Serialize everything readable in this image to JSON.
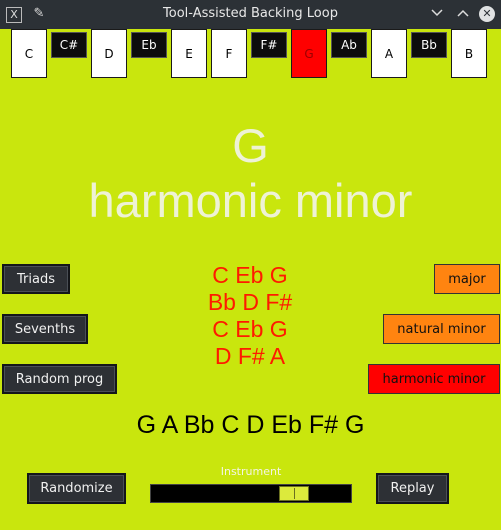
{
  "window": {
    "title": "Tool-Assisted Backing Loop",
    "app_icon": "X",
    "pin_icon": "✎"
  },
  "piano": {
    "keys": [
      {
        "label": "C",
        "color": "white"
      },
      {
        "label": "C#",
        "color": "black"
      },
      {
        "label": "D",
        "color": "white"
      },
      {
        "label": "Eb",
        "color": "black"
      },
      {
        "label": "E",
        "color": "white"
      },
      {
        "label": "F",
        "color": "white"
      },
      {
        "label": "F#",
        "color": "black"
      },
      {
        "label": "G",
        "color": "white",
        "selected": true
      },
      {
        "label": "Ab",
        "color": "black"
      },
      {
        "label": "A",
        "color": "white"
      },
      {
        "label": "Bb",
        "color": "black"
      },
      {
        "label": "B",
        "color": "white"
      }
    ],
    "selected_color": "#ff0000"
  },
  "display": {
    "root": "G",
    "scale": "harmonic minor"
  },
  "left_buttons": {
    "triads": "Triads",
    "sevenths": "Sevenths",
    "random_prog": "Random prog"
  },
  "chords": [
    "C Eb G",
    "Bb D F#",
    "C Eb G",
    "D F# A"
  ],
  "scale_buttons": {
    "major": "major",
    "natural_minor": "natural minor",
    "harmonic_minor": "harmonic minor"
  },
  "scale_notes": "G A Bb C D Eb F# G",
  "footer": {
    "randomize": "Randomize",
    "instrument_label": "Instrument",
    "replay": "Replay"
  },
  "instrument_slider": {
    "value_fraction": 0.75
  },
  "colors": {
    "background": "#c9e60d",
    "chord_text": "#ff1a00",
    "orange_button": "#ff8410",
    "active_button": "#ff0000"
  }
}
